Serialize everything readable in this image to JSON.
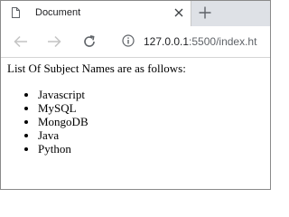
{
  "browser": {
    "tab": {
      "title": "Document",
      "page_icon": "page-icon",
      "close_icon": "close-icon"
    },
    "new_tab_icon": "plus-icon",
    "toolbar": {
      "back_icon": "back-arrow-icon",
      "forward_icon": "forward-arrow-icon",
      "reload_icon": "reload-icon",
      "site_info_icon": "info-icon"
    },
    "address_bar": {
      "host": "127.0.0.1",
      "rest": ":5500/index.ht"
    }
  },
  "page": {
    "intro_text": "List Of Subject Names are as follows:",
    "subjects": [
      "Javascript",
      "MySQL",
      "MongoDB",
      "Java",
      "Python"
    ]
  },
  "colors": {
    "tabstrip_bg": "#dee1e6",
    "disabled_icon": "#c4c4c4",
    "active_icon": "#5f6368",
    "text": "#202124"
  }
}
